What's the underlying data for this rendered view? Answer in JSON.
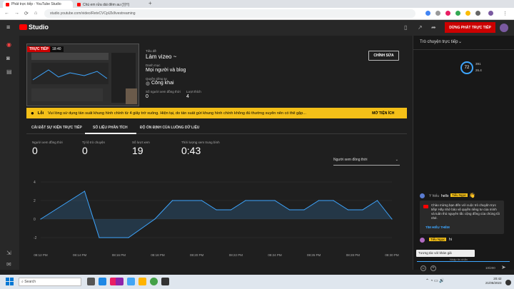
{
  "browser": {
    "tabs": [
      {
        "title": "Phát trực tiếp - YouTube Studio"
      },
      {
        "title": "Chú em rửa dái đêm au (分!!)"
      }
    ],
    "url": "studio.youtube.com/video/RetvCVCpIZk/livestreaming"
  },
  "header": {
    "logo_text": "Studio",
    "end_stream_label": "DỪNG PHÁT TRỰC TIẾP"
  },
  "stream": {
    "live_badge": "TRỰC TIẾP",
    "live_time": "18:40",
    "title_label": "Tiêu đề",
    "title_value": "Làm vizeo ~",
    "category_label": "Danh mục",
    "category_value": "Mọi người và blog",
    "privacy_label": "Quyền riêng tư",
    "privacy_value": "Công khai",
    "viewers_label": "Số người xem đồng thời",
    "viewers_value": "0",
    "likes_label": "Lượt thích",
    "likes_value": "4",
    "edit_label": "CHỈNH SỬA"
  },
  "alert": {
    "prefix": "Lỗi",
    "message": "Vui lòng sử dụng tần suất khung hình chính từ 4 giây trở xuống. Hiện tại, do tần suất gửi khung hình chính không đủ thường xuyên nên có thể gặp...",
    "action": "MỞ TIỆN ÍCH",
    "color": "#f4c018"
  },
  "tabs": [
    {
      "label": "CÀI ĐẶT SỰ KIỆN TRỰC TIẾP"
    },
    {
      "label": "SỐ LIỆU PHÂN TÍCH"
    },
    {
      "label": "ĐỘ ỔN ĐỊNH CỦA LUỒNG DỮ LIỆU"
    }
  ],
  "stats": [
    {
      "label": "Người xem đồng thời",
      "value": "0"
    },
    {
      "label": "Tỷ lệ trò chuyện",
      "value": "0"
    },
    {
      "label": "Số lượt xem",
      "value": "19"
    },
    {
      "label": "Thời lượng xem trung bình",
      "value": "0:43"
    }
  ],
  "dropdown": {
    "value": "Người xem đồng thời"
  },
  "chart_data": {
    "type": "area",
    "x": [
      "08:12 PM",
      "08:14 PM",
      "08:16 PM",
      "08:18 PM",
      "08:20 PM",
      "08:22 PM",
      "08:24 PM",
      "08:26 PM",
      "08:28 PM",
      "08:30 PM"
    ],
    "ytick_labels": [
      "4",
      "2",
      "0",
      "-2"
    ],
    "ylim": [
      -3,
      5
    ],
    "points": [
      {
        "t": 0,
        "v": 0
      },
      {
        "t": 3,
        "v": 3
      },
      {
        "t": 4,
        "v": -2
      },
      {
        "t": 6,
        "v": -2
      },
      {
        "t": 7.8,
        "v": 0
      },
      {
        "t": 9,
        "v": 2
      },
      {
        "t": 11,
        "v": 2
      },
      {
        "t": 12,
        "v": 1
      },
      {
        "t": 13,
        "v": 1
      },
      {
        "t": 14,
        "v": 2
      },
      {
        "t": 16,
        "v": 2
      },
      {
        "t": 17,
        "v": 1
      },
      {
        "t": 18,
        "v": 1
      },
      {
        "t": 19,
        "v": 2
      },
      {
        "t": 20,
        "v": 2
      },
      {
        "t": 21,
        "v": 1
      },
      {
        "t": 22,
        "v": 1
      },
      {
        "t": 23,
        "v": 2
      },
      {
        "t": 24,
        "v": 0
      }
    ],
    "t_max": 24,
    "line_color": "#3ea6ff"
  },
  "chat": {
    "title": "Trò chuyện trực tiếp",
    "viewer_count": "72",
    "stat1": "391",
    "stat2": "26.4",
    "msg1_user": "Y hiếu",
    "msg1_text": "hello",
    "msg1_badge": "Tiểu Ngọc",
    "system_text": "Chào mừng bạn đến với cuộc trò chuyện trực tiếp! Hãy nhớ bảo vệ quyền riêng tư của mình và tuân thủ nguyên tắc cộng đồng của chúng tôi nhé.",
    "learn_more": "TÌM HIỂU THÊM",
    "msg2_badge": "Tiểu Ngọc",
    "msg2_text": "hi",
    "tooltip": "Tương tác với khán giả",
    "input_placeholder": "Nhập tin nhắn",
    "char_count": "10/200"
  },
  "taskbar": {
    "search_placeholder": "Search",
    "time": "20:42",
    "date": "21/05/2023"
  }
}
